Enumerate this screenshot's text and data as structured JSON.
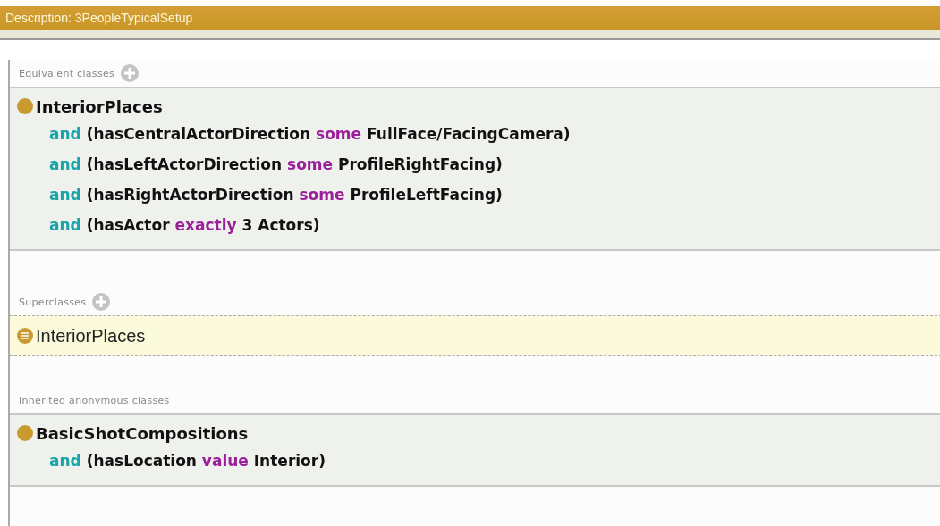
{
  "title": "Description: 3PeopleTypicalSetup",
  "sections": [
    {
      "heading": "Equivalent classes",
      "add_button": true,
      "kind": "expression",
      "items": [
        {
          "class": "InteriorPlaces",
          "lines": [
            [
              {
                "kind": "keyword",
                "text": "and"
              },
              {
                "kind": "plain",
                "text": "(hasCentralActorDirection"
              },
              {
                "kind": "restriction",
                "text": "some"
              },
              {
                "kind": "plain",
                "text": "FullFace/FacingCamera)"
              }
            ],
            [
              {
                "kind": "keyword",
                "text": "and"
              },
              {
                "kind": "plain",
                "text": "(hasLeftActorDirection"
              },
              {
                "kind": "restriction",
                "text": "some"
              },
              {
                "kind": "plain",
                "text": "ProfileRightFacing)"
              }
            ],
            [
              {
                "kind": "keyword",
                "text": "and"
              },
              {
                "kind": "plain",
                "text": "(hasRightActorDirection"
              },
              {
                "kind": "restriction",
                "text": "some"
              },
              {
                "kind": "plain",
                "text": "ProfileLeftFacing)"
              }
            ],
            [
              {
                "kind": "keyword",
                "text": "and"
              },
              {
                "kind": "plain",
                "text": "(hasActor"
              },
              {
                "kind": "restriction",
                "text": "exactly"
              },
              {
                "kind": "plain",
                "text": "3 Actors)"
              }
            ]
          ]
        }
      ]
    },
    {
      "heading": "Superclasses",
      "add_button": true,
      "kind": "named",
      "items": [
        {
          "class": "InteriorPlaces"
        }
      ]
    },
    {
      "heading": "Inherited anonymous classes",
      "add_button": false,
      "kind": "expression",
      "items": [
        {
          "class": "BasicShotCompositions",
          "lines": [
            [
              {
                "kind": "keyword",
                "text": "and"
              },
              {
                "kind": "plain",
                "text": "(hasLocation"
              },
              {
                "kind": "restriction",
                "text": "value"
              },
              {
                "kind": "plain",
                "text": "Interior)"
              }
            ]
          ]
        }
      ]
    }
  ]
}
